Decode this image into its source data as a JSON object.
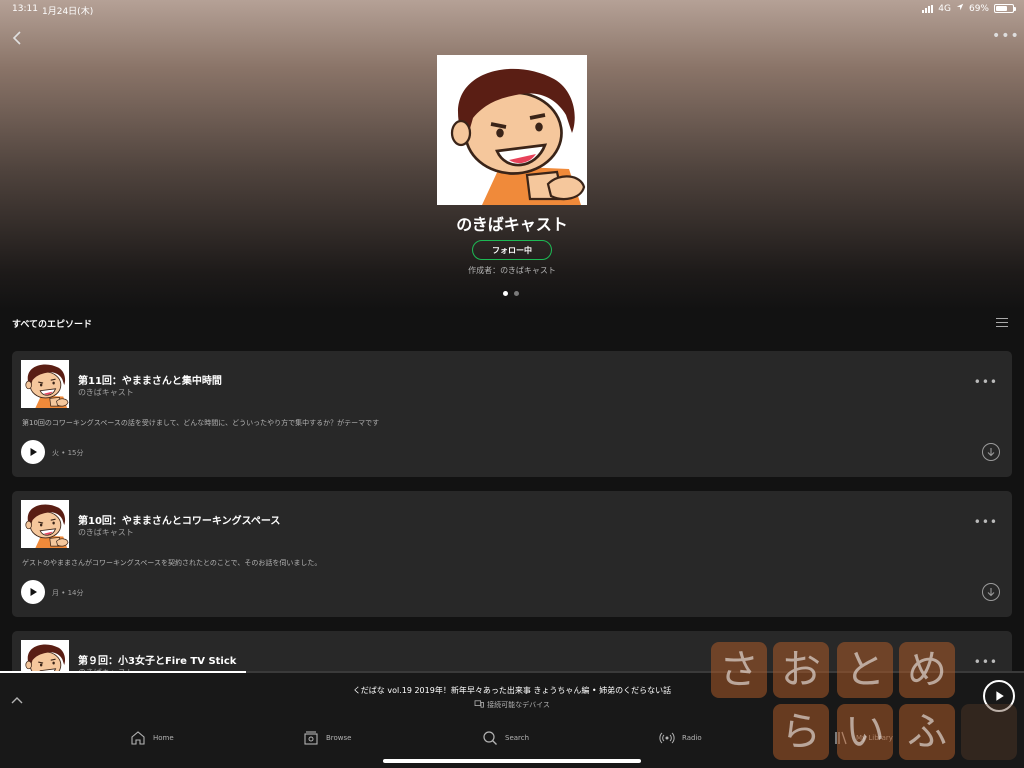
{
  "status_bar": {
    "time": "13:11",
    "date": "1月24日(木)",
    "network": "4G",
    "battery": "69%",
    "battery_level": 0.69
  },
  "header": {
    "back_icon": "chevron-left-icon",
    "more_icon": "more-horizontal-icon"
  },
  "show": {
    "title": "のきばキャスト",
    "follow_label": "フォロー中",
    "creator": "作成者：のきばキャスト",
    "page_indicator": {
      "pages": 2,
      "current": 1
    }
  },
  "episodes_section": {
    "title": "すべてのエピソード",
    "sort_icon": "list-icon"
  },
  "episodes": [
    {
      "title": "第11回：やままさんと集中時間",
      "show": "のきばキャスト",
      "description": "第10回のコワーキングスペースの話を受けまして、どんな時間に、どういったやり方で集中するか？がテーマです",
      "meta": "火 • 15分"
    },
    {
      "title": "第10回：やままさんとコワーキングスペース",
      "show": "のきばキャスト",
      "description": "ゲストのやままさんがコワーキングスペースを契約されたとのことで、そのお話を伺いました。",
      "meta": "月 • 14分"
    },
    {
      "title": "第９回：小3女子とFire TV Stick",
      "show": "のきばキャスト",
      "description": "",
      "meta": ""
    }
  ],
  "now_playing": {
    "title": "くだばな vol.19 2019年！新年早々あった出来事 きょうちゃん編 • 姉弟のくだらない話",
    "device": "接続可能なデバイス",
    "progress": 0.24
  },
  "tabs": [
    {
      "label": "Home",
      "icon": "home-icon"
    },
    {
      "label": "Browse",
      "icon": "browse-icon"
    },
    {
      "label": "Search",
      "icon": "search-icon"
    },
    {
      "label": "Radio",
      "icon": "radio-icon"
    },
    {
      "label": "My Library",
      "icon": "library-icon"
    }
  ],
  "watermark": {
    "text": "さおとめらいふ"
  },
  "colors": {
    "accent": "#1db954",
    "background": "#121212",
    "card": "#282828"
  }
}
